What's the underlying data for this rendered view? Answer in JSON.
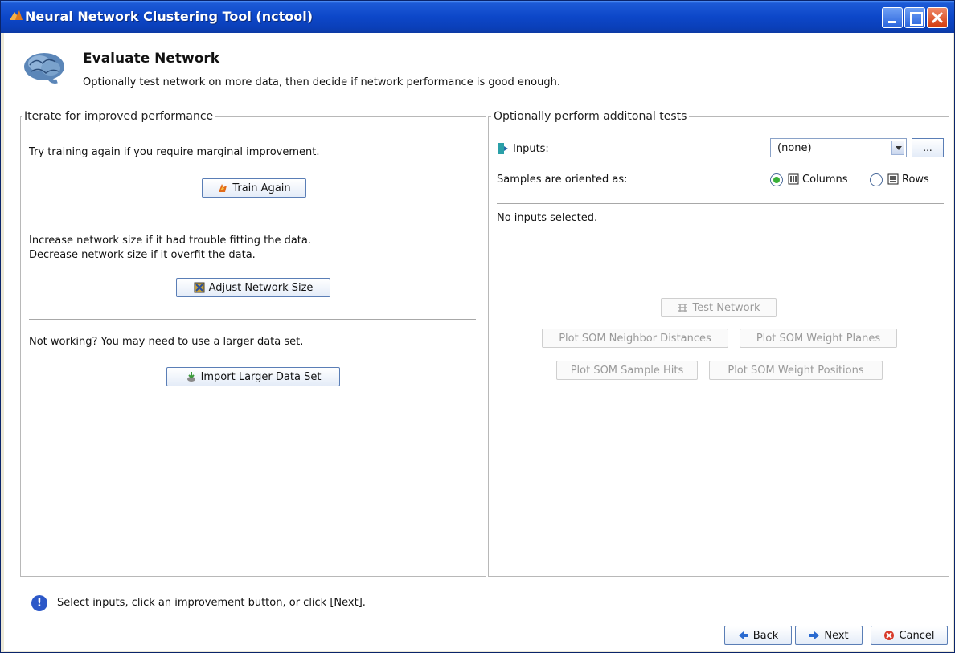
{
  "window": {
    "title": "Neural Network Clustering Tool (nctool)"
  },
  "header": {
    "title": "Evaluate Network",
    "subtitle": "Optionally test network on more data, then decide if network performance is good enough."
  },
  "left_panel": {
    "legend": "Iterate for improved performance",
    "train_text": "Try training again if you require marginal improvement.",
    "train_button": "Train Again",
    "size_text_1": "Increase network size if it had trouble fitting the data.",
    "size_text_2": "Decrease network size if it overfit the data.",
    "adjust_button": "Adjust Network Size",
    "data_text": "Not working? You may need to use a larger data set.",
    "import_button": "Import Larger Data Set"
  },
  "right_panel": {
    "legend": "Optionally perform additonal tests",
    "inputs_label": "Inputs:",
    "inputs_value": "(none)",
    "browse_button": "...",
    "orientation_label": "Samples are oriented as:",
    "columns_label": "Columns",
    "rows_label": "Rows",
    "orientation_selected": "Columns",
    "status_text": "No inputs selected.",
    "test_button": "Test Network",
    "plot_neighbor_button": "Plot SOM Neighbor Distances",
    "plot_weight_planes_button": "Plot SOM Weight Planes",
    "plot_sample_hits_button": "Plot SOM Sample Hits",
    "plot_weight_positions_button": "Plot SOM Weight Positions"
  },
  "footer": {
    "hint": "Select inputs, click an improvement button, or click [Next].",
    "back_button": "Back",
    "next_button": "Next",
    "cancel_button": "Cancel"
  },
  "colors": {
    "titlebar": "#0d47c9",
    "radio_on": "#38b038",
    "info": "#2c58c8"
  }
}
